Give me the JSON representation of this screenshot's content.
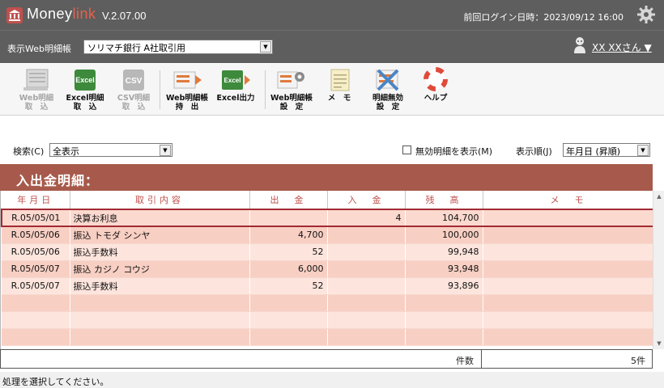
{
  "app": {
    "name_main": "Money",
    "name_accent": "link",
    "version": "V.2.07.00",
    "last_login": "前回ログイン日時：2023/09/12 16:00"
  },
  "account": {
    "label": "表示Web明細帳",
    "selected": "ソリマチ銀行 A社取引用",
    "user": "XX XXさん ▼"
  },
  "toolbar": {
    "web_import": "Web明細\n取　込",
    "excel_import": "Excel明細\n取　込",
    "csv_import": "CSV明細\n取　込",
    "web_export": "Web明細帳\n持　出",
    "excel_output": "Excel出力",
    "web_settings": "Web明細帳\n設　定",
    "memo": "メ　モ",
    "invalid_settings": "明細無効\n設　定",
    "help": "ヘルプ",
    "icon_excel_text": "Excel",
    "icon_csv_text": "CSV"
  },
  "filter": {
    "search_label": "検索(C)",
    "search_value": "全表示",
    "show_invalid_label": "無効明細を表示(M)",
    "order_label": "表示順(J)",
    "order_value": "年月日 (昇順)"
  },
  "section": {
    "title": "入出金明細："
  },
  "table": {
    "headers": [
      "年月日",
      "取引内容",
      "出　金",
      "入　金",
      "残　高",
      "メ　モ"
    ],
    "rows": [
      {
        "date": "R.05/05/01",
        "desc": "決算お利息",
        "out": "",
        "in": "4",
        "balance": "104,700",
        "memo": ""
      },
      {
        "date": "R.05/05/06",
        "desc": "振込 トモダ シンヤ",
        "out": "4,700",
        "in": "",
        "balance": "100,000",
        "memo": ""
      },
      {
        "date": "R.05/05/06",
        "desc": "振込手数料",
        "out": "52",
        "in": "",
        "balance": "99,948",
        "memo": ""
      },
      {
        "date": "R.05/05/07",
        "desc": "振込 カジノ コウジ",
        "out": "6,000",
        "in": "",
        "balance": "93,948",
        "memo": ""
      },
      {
        "date": "R.05/05/07",
        "desc": "振込手数料",
        "out": "52",
        "in": "",
        "balance": "93,896",
        "memo": ""
      }
    ],
    "count_label": "件数",
    "count_value": "5件"
  },
  "status": {
    "message": "処理を選択してください。"
  },
  "colors": {
    "titlebar": "#5e5e5e",
    "section": "#a75a4b",
    "accent": "#e8614b",
    "row_odd": "#f8cfc3",
    "row_even": "#fde5dd",
    "selection": "#a12a33"
  }
}
